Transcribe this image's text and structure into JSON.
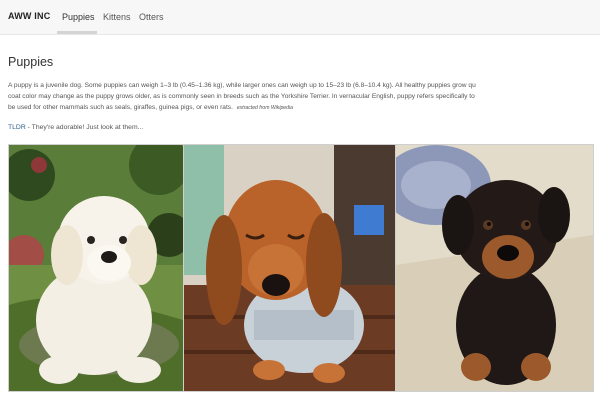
{
  "navbar": {
    "brand": "AWW INC",
    "items": [
      {
        "label": "Puppies",
        "active": true
      },
      {
        "label": "Kittens",
        "active": false
      },
      {
        "label": "Otters",
        "active": false
      }
    ]
  },
  "article": {
    "title": "Puppies",
    "paragraph_lines": [
      "A puppy is a juvenile dog. Some puppies can weigh 1–3 lb (0.45–1.36 kg), while larger ones can weigh up to 15–23 lb (6.8–10.4 kg). All healthy puppies grow qu",
      "coat color may change as the puppy grows older, as is commonly seen in breeds such as the Yorkshire Terrier. In vernacular English, puppy refers specifically to",
      "be used for other mammals such as seals, giraffes, guinea pigs, or even rats."
    ],
    "source_note": "extracted from Wikipedia",
    "tldr_label": "TLDR",
    "tldr_text": " - They're adorable! Just look at them..."
  },
  "gallery": {
    "photos": [
      {
        "subject": "white golden retriever puppy on mossy rock"
      },
      {
        "subject": "dachshund puppy in grey sweater"
      },
      {
        "subject": "rottweiler puppy on carpet"
      }
    ]
  },
  "colors": {
    "navbar_bg": "#f7f7f7",
    "active_underline": "#d4d4d4",
    "tldr_link": "#2e5f8a"
  }
}
